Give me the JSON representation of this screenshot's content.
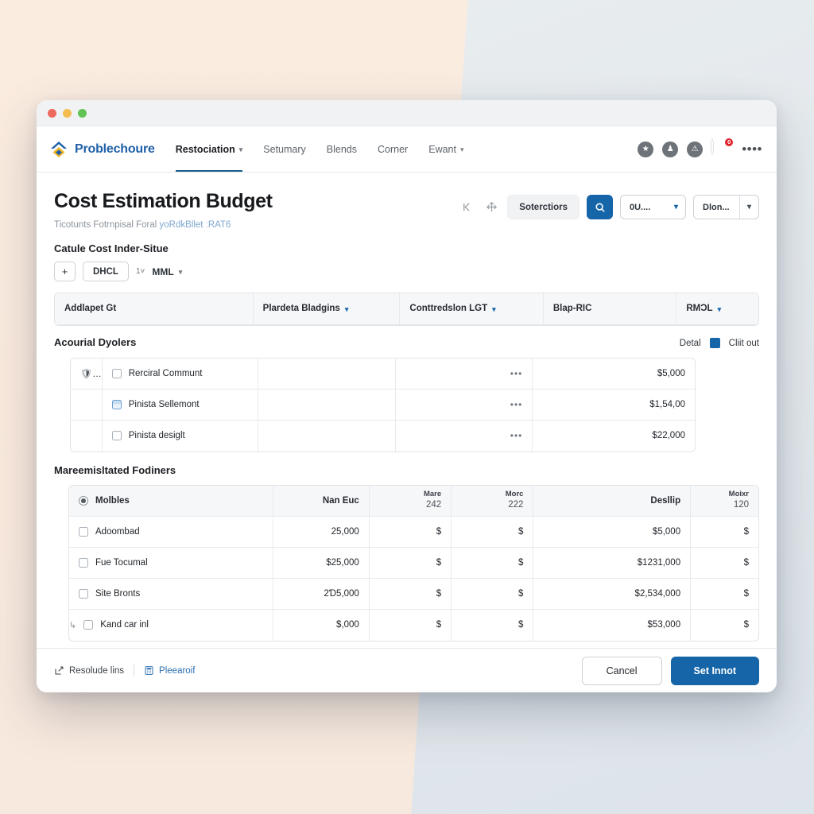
{
  "background": {
    "left_color": "#faeade",
    "right_color": "#e4e9ed"
  },
  "window": {
    "traffic_lights": [
      "close",
      "minimize",
      "zoom"
    ]
  },
  "nav": {
    "brand": "Problechoure",
    "brand_icon": "diamond-chevron-logo-icon",
    "links": [
      {
        "label": "Restociation",
        "has_caret": true,
        "active": true
      },
      {
        "label": "Setumary",
        "has_caret": false,
        "active": false
      },
      {
        "label": "Blends",
        "has_caret": false,
        "active": false
      },
      {
        "label": "Corner",
        "has_caret": false,
        "active": false
      },
      {
        "label": "Ewant",
        "has_caret": true,
        "active": false
      }
    ],
    "right_icons": [
      {
        "name": "star-icon",
        "glyph": "★"
      },
      {
        "name": "person-icon",
        "glyph": "♟"
      },
      {
        "name": "alert-icon",
        "glyph": "⚠"
      }
    ],
    "avatar_badge": "0",
    "overflow_glyph": "••••"
  },
  "page": {
    "title": "Cost Estimation Budget",
    "subtitle_plain": "Ticotunts Fotrnpisal Foral ",
    "subtitle_link": "yoRdkBllet ːRAT6"
  },
  "toolbar": {
    "collapse_icon": "collapse-left-icon",
    "expand_icon": "expand-arrows-icon",
    "filter_label": "Soterctiors",
    "search_icon": "search-icon",
    "select_one": "0U....",
    "select_two": "Dlon..."
  },
  "section": {
    "label": "Catule Cost Inder-Situe",
    "add_button": "+",
    "chip_button": "DHCL",
    "counter": "1˅",
    "inline_select": "MML"
  },
  "legend": {
    "detail_label": "Detal",
    "swatch_color": "#1565a8",
    "swatch_label": "Cliit out"
  },
  "table1": {
    "columns": [
      {
        "label": "Addlapet Gt",
        "caret": false,
        "align": "left"
      },
      {
        "label": "Plardeta Bladgins",
        "caret": true,
        "align": "left"
      },
      {
        "label": "Conttredslon LGT",
        "caret": true,
        "align": "left"
      },
      {
        "label": "Blap-RIC",
        "caret": false,
        "align": "left"
      },
      {
        "label": "RMƆL",
        "caret": true,
        "align": "left"
      }
    ],
    "group_title": "Acourial Dyolers",
    "rows": [
      {
        "icon": "shield-icon",
        "check": "unchecked",
        "name": "Rerciral Communt",
        "c2": "",
        "c3": "•••",
        "c4": "$5,000"
      },
      {
        "icon": "",
        "check": "document",
        "name": "Pinista Sellemont",
        "c2": "",
        "c3": "•••",
        "c4": "$1,54,00"
      },
      {
        "icon": "",
        "check": "unchecked",
        "name": "Pinista desiglt",
        "c2": "",
        "c3": "•••",
        "c4": "$22,000"
      }
    ]
  },
  "table2": {
    "group_title": "Mareemisltated Fodiners",
    "columns": [
      {
        "label": "Molbles",
        "sub": "",
        "align": "left",
        "radio": true
      },
      {
        "label": "Nan Euc",
        "sub": "",
        "align": "right"
      },
      {
        "label": "Mare",
        "sub": "242",
        "align": "right"
      },
      {
        "label": "Morc",
        "sub": "222",
        "align": "right"
      },
      {
        "label": "Desllip",
        "sub": "",
        "align": "right"
      },
      {
        "label": "Moixr",
        "sub": "120",
        "align": "right"
      }
    ],
    "rows": [
      {
        "tick": false,
        "name": "Adoombad",
        "v1": "25,000",
        "v2": "$",
        "v3": "$",
        "v4": "$5,000",
        "v5": "$"
      },
      {
        "tick": false,
        "name": "Fue Tocumal",
        "v1": "$25,000",
        "v2": "$",
        "v3": "$",
        "v4": "$1231,000",
        "v5": "$"
      },
      {
        "tick": false,
        "name": "Site Bronts",
        "v1": "2Ɗ5,000",
        "v2": "$",
        "v3": "$",
        "v4": "$2,534,000",
        "v5": "$"
      },
      {
        "tick": true,
        "name": "Kand car inl",
        "v1": "$,000",
        "v2": "$",
        "v3": "$",
        "v4": "$53,000",
        "v5": "$"
      }
    ]
  },
  "footer": {
    "link1": "Resolude lins",
    "link1_icon": "edit-square-icon",
    "link2": "Pleearoif",
    "link2_icon": "calculator-icon",
    "cancel": "Cancel",
    "submit": "Set Innot"
  }
}
